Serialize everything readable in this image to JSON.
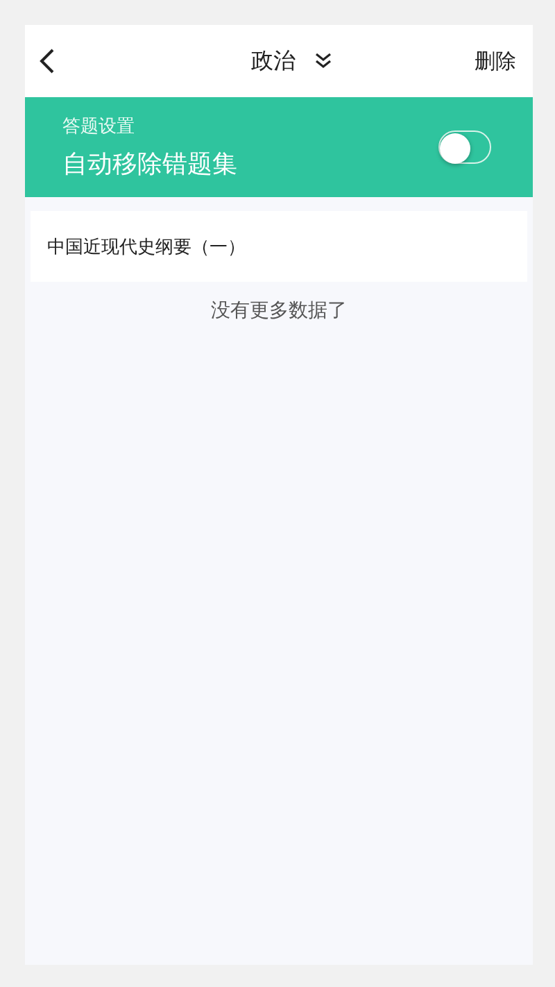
{
  "header": {
    "title": "政治",
    "action": "删除"
  },
  "settings": {
    "label": "答题设置",
    "title": "自动移除错题集",
    "on": false
  },
  "items": [
    {
      "title": "中国近现代史纲要（一）"
    }
  ],
  "footer": "没有更多数据了"
}
